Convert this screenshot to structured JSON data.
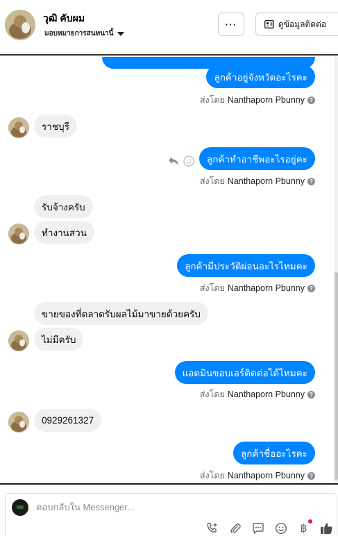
{
  "header": {
    "contact_name": "วุฒิ คับผม",
    "assign_label": "มอบหมายการสนทนานี้",
    "more_label": "···",
    "contact_info_label": "ดูข้อมูลติดต่อ"
  },
  "messages": [
    {
      "text": "ลูกค้าอยู่จังหวัดอะไรคะ"
    },
    {
      "text": "ราชบุรี"
    },
    {
      "text": "ลูกค้าทำอาชีพอะไรอยู่คะ"
    },
    {
      "text": "รับจ้างครับ"
    },
    {
      "text": "ทำงานสวน"
    },
    {
      "text": "ลูกค้ามีประวัติผ่อนอะไรไหมคะ"
    },
    {
      "text": "ขายของที่ตลาดรับผลไม้มาขายด้วยครับ"
    },
    {
      "text": "ไม่มีครับ"
    },
    {
      "text": "แอดมินขอบเอร์ติดต่อได้ไหมคะ"
    },
    {
      "text": "0929261327"
    },
    {
      "text": "ลูกค้าชื่ออะไรคะ"
    }
  ],
  "sent_by": {
    "prefix": "ส่งโดย",
    "sender": "Nanthaporn Pbunny",
    "help": "?"
  },
  "composer": {
    "placeholder": "ตอบกลับใน Messenger..."
  },
  "colors": {
    "outgoing_bubble": "#0084ff",
    "incoming_bubble": "#f0f0f0",
    "notification_dot": "#e41e3f"
  },
  "icons": {
    "more": "ellipsis-icon",
    "contact": "contact-card-icon",
    "reply": "reply-icon",
    "react": "smiley-icon",
    "call": "add-call-icon",
    "attach": "paperclip-icon",
    "saved_reply": "chat-bubble-icon",
    "emoji": "emoji-icon",
    "payment": "baht-icon",
    "like": "thumbs-up-icon"
  }
}
